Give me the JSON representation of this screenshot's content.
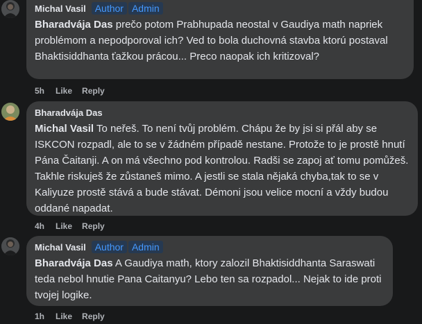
{
  "comments": [
    {
      "author": "Michal Vasil",
      "badges": [
        "Author",
        "Admin"
      ],
      "mention": "Bharadvája Das",
      "text": " prečo potom Prabhupada neostal v Gaudiya math napriek problémom a nepodporoval ich? Ved to bola duchovná stavba ktorú postaval Bhaktisiddhanta ťažkou prácou... Preco naopak ich kritizoval?",
      "time": "5h",
      "like": "Like",
      "reply": "Reply"
    },
    {
      "author": "Bharadvája Das",
      "badges": [],
      "mention": "Michal Vasil",
      "text": " To neřeš. To není tvůj problém. Chápu že by jsi si přál aby se ISKCON rozpadl, ale to se v žádném případě nestane. Protože to je prostě hnutí Pána Čaitanji. A on má všechno pod kontrolou. Radši se zapoj ať tomu pomůžeš. Takhle riskuješ že zůstaneš mimo. A jestli se stala nějaká chyba,tak to se v Kaliyuze prostě stává a bude stávat. Démoni jsou velice mocní a vždy budou oddané napadat.",
      "time": "4h",
      "like": "Like",
      "reply": "Reply"
    },
    {
      "author": "Michal Vasil",
      "badges": [
        "Author",
        "Admin"
      ],
      "mention": "Bharadvája Das",
      "text": " A Gaudiya math, ktory zalozil Bhaktisiddhanta Saraswati teda nebol hnutie Pana Caitanyu? Lebo ten sa rozpadol... Nejak to ide proti tvojej logike.",
      "time": "1h",
      "like": "Like",
      "reply": "Reply"
    }
  ],
  "colors": {
    "background": "#18191a",
    "bubble": "#3a3b3c",
    "text": "#e4e6eb",
    "meta": "#b0b3b8",
    "badge_bg": "#263951",
    "badge_fg": "#4599ff"
  }
}
